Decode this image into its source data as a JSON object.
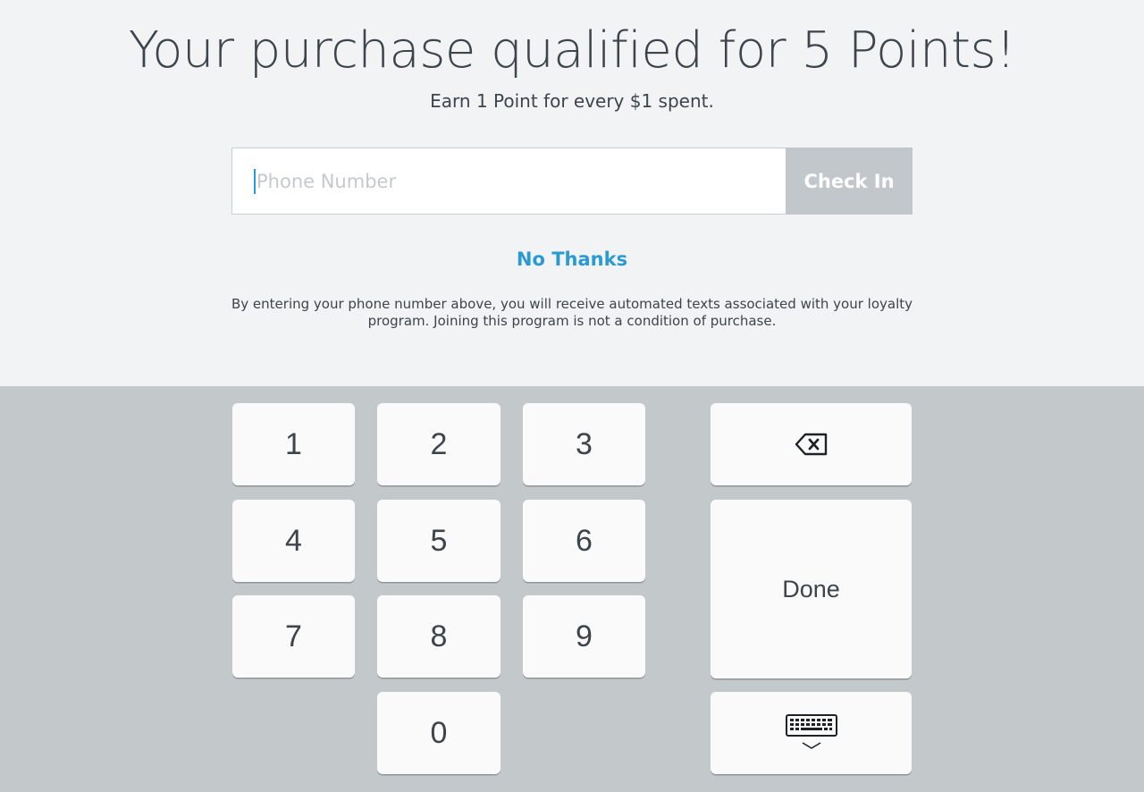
{
  "header": {
    "title": "Your purchase qualified for 5 Points!",
    "subtitle": "Earn 1 Point for every $1 spent."
  },
  "form": {
    "phone_value": "",
    "phone_placeholder": "Phone Number",
    "check_in_label": "Check In"
  },
  "no_thanks_label": "No Thanks",
  "disclaimer_line1": "By entering your phone number above, you will receive automated texts associated with your loyalty",
  "disclaimer_line2": "program. Joining this program is not a condition of purchase.",
  "keypad": {
    "digits": [
      "1",
      "2",
      "3",
      "4",
      "5",
      "6",
      "7",
      "8",
      "9",
      "0"
    ],
    "done_label": "Done",
    "backspace_icon": "backspace-icon",
    "hide_keyboard_icon": "hide-keyboard-icon"
  },
  "colors": {
    "accent": "#2b9ad3",
    "text": "#3d444b",
    "button_disabled": "#c2c7cb",
    "keypad_bg": "#c3c8cb",
    "page_bg": "#f2f3f5"
  }
}
